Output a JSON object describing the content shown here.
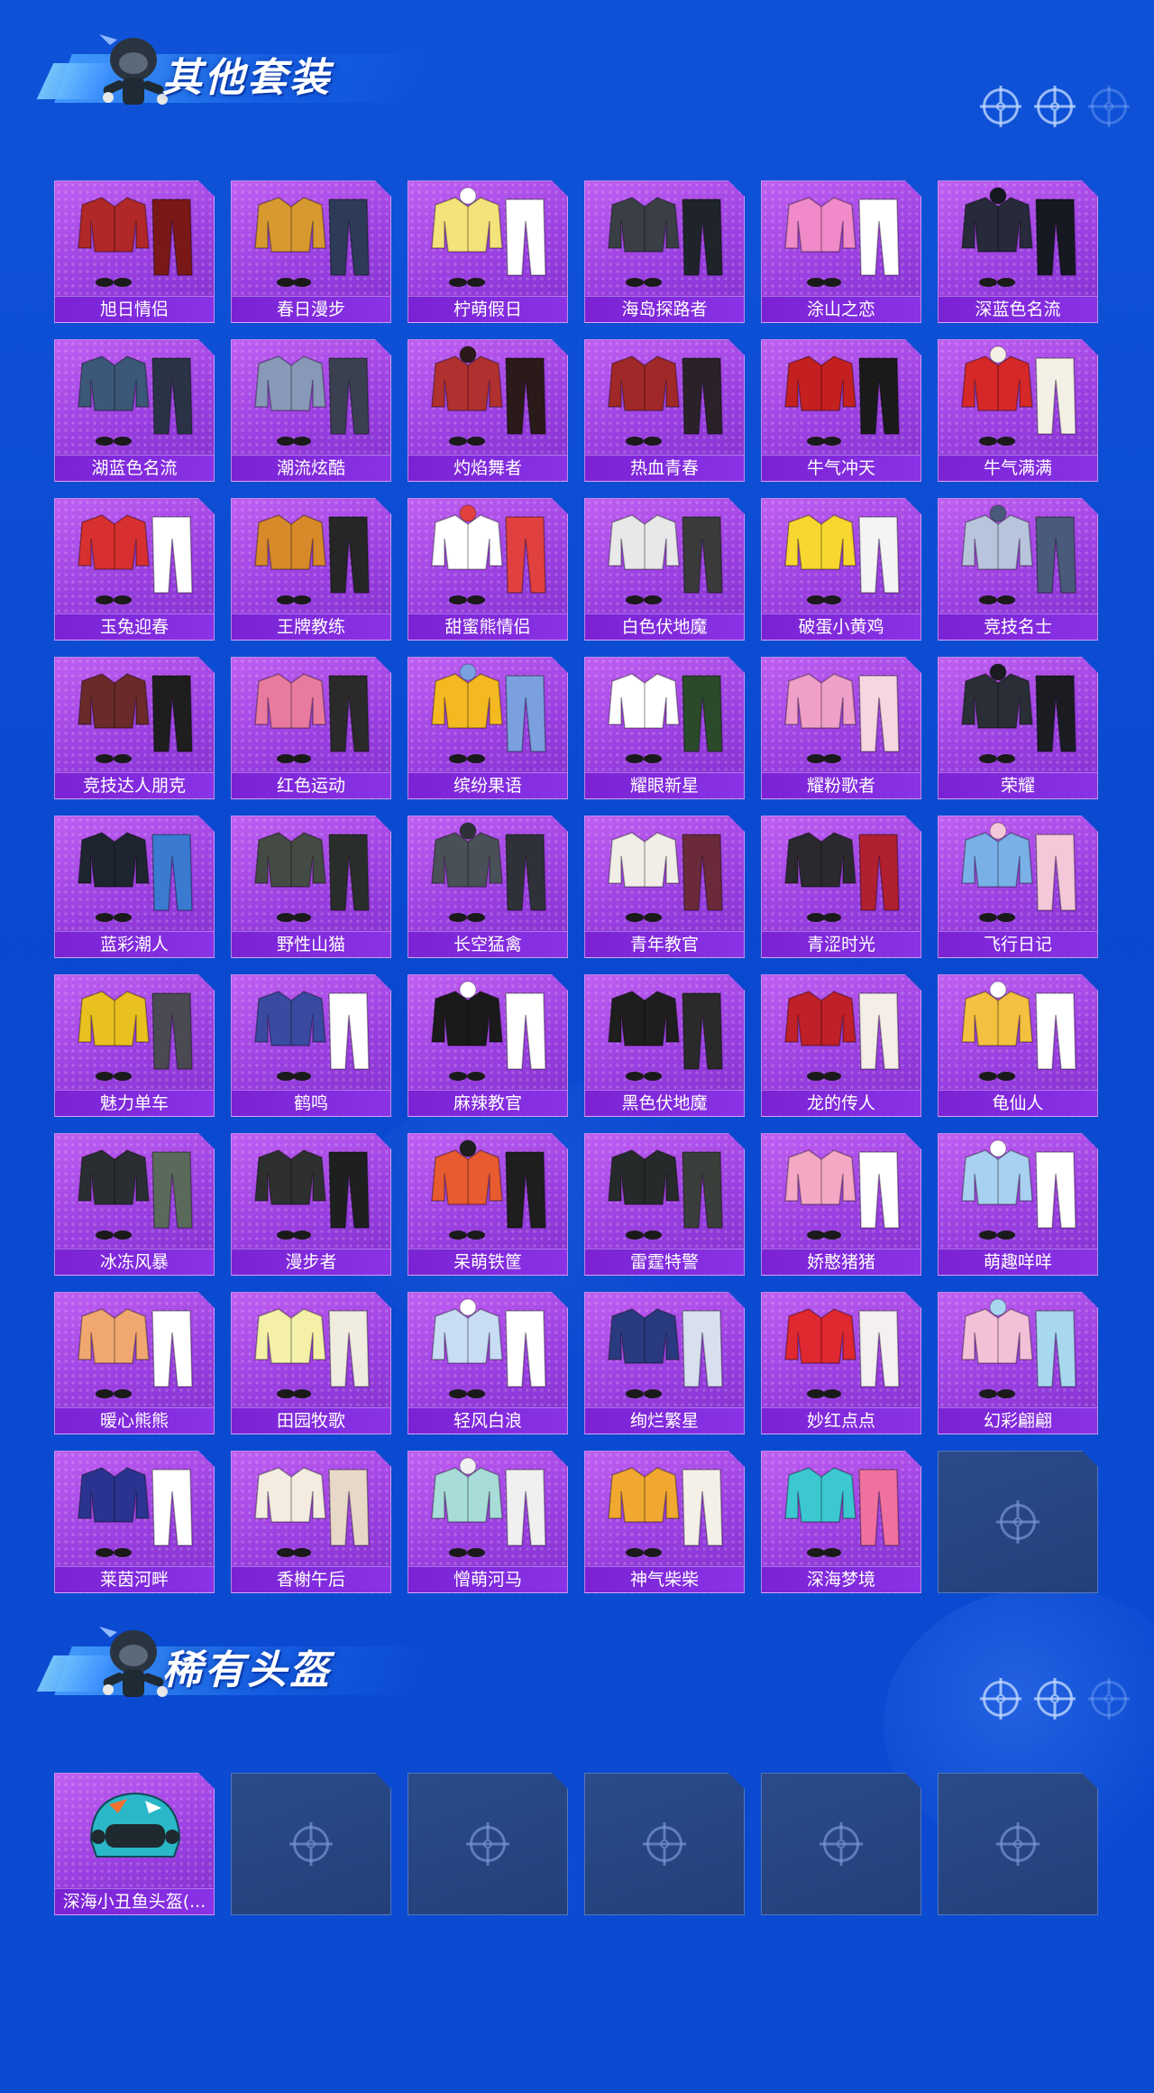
{
  "sections": [
    {
      "title": "其他套装",
      "items": [
        {
          "name": "旭日情侣",
          "palette": [
            "#b02828",
            "#7a1818"
          ]
        },
        {
          "name": "春日漫步",
          "palette": [
            "#d89a30",
            "#2d3a58"
          ]
        },
        {
          "name": "柠萌假日",
          "palette": [
            "#f4e27a",
            "#ffffff"
          ]
        },
        {
          "name": "海岛探路者",
          "palette": [
            "#3a3f46",
            "#1f242a"
          ]
        },
        {
          "name": "涂山之恋",
          "palette": [
            "#f08ac8",
            "#ffffff"
          ]
        },
        {
          "name": "深蓝色名流",
          "palette": [
            "#262a3a",
            "#161822"
          ]
        },
        {
          "name": "湖蓝色名流",
          "palette": [
            "#3b5878",
            "#2a3346"
          ]
        },
        {
          "name": "潮流炫酷",
          "palette": [
            "#8898b8",
            "#3a4050"
          ]
        },
        {
          "name": "灼焰舞者",
          "palette": [
            "#b03030",
            "#2a1a1a"
          ]
        },
        {
          "name": "热血青春",
          "palette": [
            "#a02828",
            "#2a2228"
          ]
        },
        {
          "name": "牛气冲天",
          "palette": [
            "#c42020",
            "#1a1a1a"
          ]
        },
        {
          "name": "牛气满满",
          "palette": [
            "#d62828",
            "#f4f0e6"
          ]
        },
        {
          "name": "玉兔迎春",
          "palette": [
            "#d83030",
            "#ffffff"
          ]
        },
        {
          "name": "王牌教练",
          "palette": [
            "#d88a2a",
            "#262626"
          ]
        },
        {
          "name": "甜蜜熊情侣",
          "palette": [
            "#ffffff",
            "#e04040"
          ]
        },
        {
          "name": "白色伏地魔",
          "palette": [
            "#e8e8e8",
            "#3a3a3a"
          ]
        },
        {
          "name": "破蛋小黄鸡",
          "palette": [
            "#f8d830",
            "#f4f4f4"
          ]
        },
        {
          "name": "竞技名士",
          "palette": [
            "#b8c4dc",
            "#4a5a7a"
          ]
        },
        {
          "name": "竞技达人朋克",
          "palette": [
            "#6a2a2a",
            "#1e1e1e"
          ]
        },
        {
          "name": "红色运动",
          "palette": [
            "#e87aa0",
            "#2a2a2a"
          ]
        },
        {
          "name": "缤纷果语",
          "palette": [
            "#f4b820",
            "#7aa0e0"
          ]
        },
        {
          "name": "耀眼新星",
          "palette": [
            "#ffffff",
            "#2a4a2a"
          ]
        },
        {
          "name": "耀粉歌者",
          "palette": [
            "#f0a0c8",
            "#f6d6e0"
          ]
        },
        {
          "name": "荣耀",
          "palette": [
            "#2a2e36",
            "#1a1c22"
          ]
        },
        {
          "name": "蓝彩潮人",
          "palette": [
            "#1e2430",
            "#3a7ad0"
          ]
        },
        {
          "name": "野性山猫",
          "palette": [
            "#444a44",
            "#2a2e2a"
          ]
        },
        {
          "name": "长空猛禽",
          "palette": [
            "#4a5058",
            "#2e3238"
          ]
        },
        {
          "name": "青年教官",
          "palette": [
            "#f0eee6",
            "#6a2a3a"
          ]
        },
        {
          "name": "青涩时光",
          "palette": [
            "#2a2a2e",
            "#b02030"
          ]
        },
        {
          "name": "飞行日记",
          "palette": [
            "#7ab0e8",
            "#f4c8d8"
          ]
        },
        {
          "name": "魅力单车",
          "palette": [
            "#e8c020",
            "#4a4a52"
          ]
        },
        {
          "name": "鹤鸣",
          "palette": [
            "#3a4aa0",
            "#ffffff"
          ]
        },
        {
          "name": "麻辣教官",
          "palette": [
            "#1a1a1a",
            "#ffffff"
          ]
        },
        {
          "name": "黑色伏地魔",
          "palette": [
            "#1e1e1e",
            "#2a2a2a"
          ]
        },
        {
          "name": "龙的传人",
          "palette": [
            "#c02028",
            "#f4eee6"
          ]
        },
        {
          "name": "龟仙人",
          "palette": [
            "#f4c040",
            "#ffffff"
          ]
        },
        {
          "name": "冰冻风暴",
          "palette": [
            "#2a2e32",
            "#5a6a5a"
          ]
        },
        {
          "name": "漫步者",
          "palette": [
            "#2e3030",
            "#1e2020"
          ]
        },
        {
          "name": "呆萌铁筐",
          "palette": [
            "#e85a30",
            "#1e1e1e"
          ]
        },
        {
          "name": "雷霆特警",
          "palette": [
            "#262a2a",
            "#3a3e3a"
          ]
        },
        {
          "name": "娇憨猪猪",
          "palette": [
            "#f4a8c4",
            "#ffffff"
          ]
        },
        {
          "name": "萌趣咩咩",
          "palette": [
            "#a8d0f0",
            "#ffffff"
          ]
        },
        {
          "name": "暖心熊熊",
          "palette": [
            "#f0a870",
            "#ffffff"
          ]
        },
        {
          "name": "田园牧歌",
          "palette": [
            "#f4f0a8",
            "#f0ece0"
          ]
        },
        {
          "name": "轻风白浪",
          "palette": [
            "#c8dcf4",
            "#ffffff"
          ]
        },
        {
          "name": "绚烂繁星",
          "palette": [
            "#2a3a80",
            "#d8e0f0"
          ]
        },
        {
          "name": "妙红点点",
          "palette": [
            "#e02830",
            "#f4f0f0"
          ]
        },
        {
          "name": "幻彩翩翩",
          "palette": [
            "#f4c0d8",
            "#a8d8f0"
          ]
        },
        {
          "name": "莱茵河畔",
          "palette": [
            "#2a3490",
            "#ffffff"
          ]
        },
        {
          "name": "香榭午后",
          "palette": [
            "#f4ece0",
            "#e8d8c8"
          ]
        },
        {
          "name": "憎萌河马",
          "palette": [
            "#a8dcd8",
            "#f0f0f0"
          ]
        },
        {
          "name": "神气柴柴",
          "palette": [
            "#f0a830",
            "#f4f0e8"
          ]
        },
        {
          "name": "深海梦境",
          "palette": [
            "#3cc8d0",
            "#f070a0"
          ]
        }
      ],
      "empty_slots": 1
    },
    {
      "title": "稀有头盔",
      "items": [
        {
          "name": "深海小丑鱼头盔(...",
          "palette": [
            "#2ab8c8",
            "#1e2a30"
          ]
        }
      ],
      "empty_slots": 5
    }
  ],
  "colors": {
    "background": "#0f52d8",
    "card_purple": "#9a3fe0",
    "label_bar": "#7a22d4",
    "empty_slot": "#26437e"
  }
}
